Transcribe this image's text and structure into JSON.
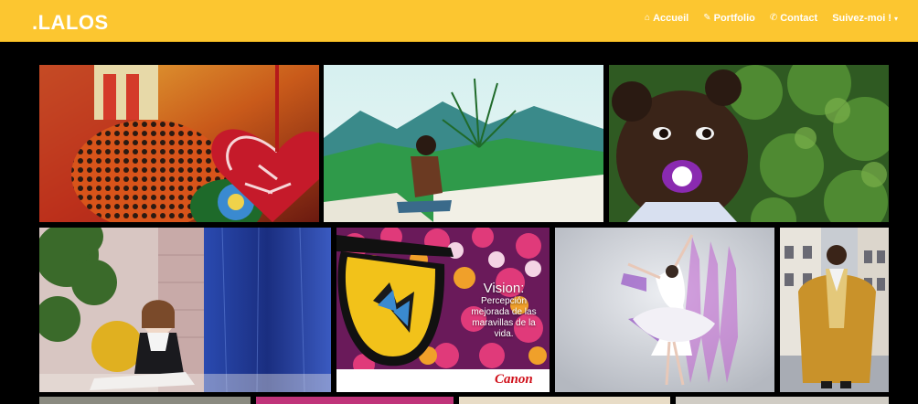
{
  "brand": ".LALOS",
  "nav": {
    "items": [
      {
        "label": "Accueil",
        "icon": "home-icon"
      },
      {
        "label": "Portfolio",
        "icon": "pencil-icon"
      },
      {
        "label": "Contact",
        "icon": "phone-icon"
      },
      {
        "label": "Suivez-moi !",
        "icon": "chevron-down-icon"
      }
    ]
  },
  "gallery": {
    "rows": [
      [
        {
          "subject": "red heart ornament"
        },
        {
          "subject": "boy sitting on beach"
        },
        {
          "subject": "child with pacifier"
        }
      ],
      [
        {
          "subject": "girl sitting by blue wall"
        },
        {
          "subject": "sunglasses over tulips"
        },
        {
          "subject": "ballet dancer"
        },
        {
          "subject": "man in golden robe"
        }
      ]
    ],
    "ad": {
      "title": "Vision:",
      "body": "Percepción mejorada de las maravillas de la vida.",
      "brand": "Canon"
    }
  },
  "colors": {
    "navbar": "#fcc630",
    "background": "#000000",
    "canon_red": "#d0101a"
  }
}
